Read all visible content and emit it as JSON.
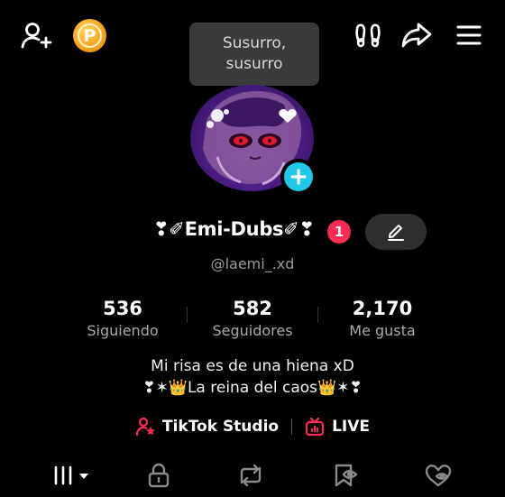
{
  "tooltip": {
    "line1": "Susurro,",
    "line2": "susurro"
  },
  "top_bar": {
    "add_friend_icon": "person-plus-icon",
    "coins_icon": "coin-icon",
    "coin_letter": "P",
    "footprints_icon": "footprints-icon",
    "share_icon": "share-arrow-icon",
    "menu_icon": "hamburger-menu-icon"
  },
  "profile": {
    "display_name": "❣︎✐Emi-Dubs✐❣︎",
    "name_badge": "1",
    "username": "@laemi_.xd"
  },
  "stats": [
    {
      "value": "536",
      "label": "Siguiendo"
    },
    {
      "value": "582",
      "label": "Seguidores"
    },
    {
      "value": "2,170",
      "label": "Me gusta"
    }
  ],
  "bio": {
    "line1": "Mi risa es de una hiena xD",
    "line2": "❣︎✶👑La reina del caos👑✶❣︎"
  },
  "links": {
    "studio_label": "TikTok Studio",
    "live_label": "LIVE"
  },
  "colors": {
    "accent_red": "#fe2c55",
    "add_blue": "#20c7e8",
    "coin_gold": "#f6a623"
  },
  "tabs": [
    "videos-grid-icon",
    "lock-icon",
    "repost-icon",
    "favorites-icon",
    "liked-heart-icon"
  ]
}
